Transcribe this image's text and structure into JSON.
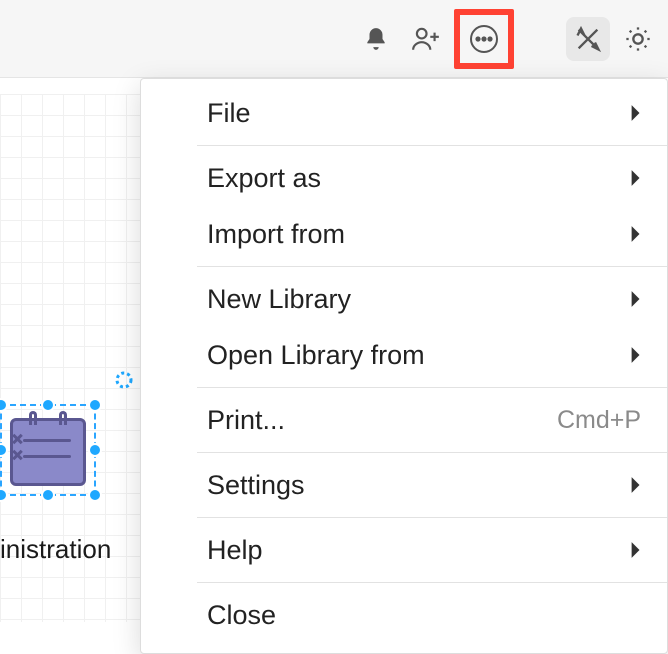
{
  "toolbar": {
    "icons": {
      "bell": "bell-icon",
      "add_user": "person-add-icon",
      "more": "more-horizontal-icon",
      "design": "design-tools-icon",
      "brightness": "brightness-icon"
    }
  },
  "canvas": {
    "selected_shape_label": "inistration"
  },
  "menu": {
    "items": [
      {
        "label": "File",
        "submenu": true
      },
      {
        "sep": true
      },
      {
        "label": "Export as",
        "submenu": true
      },
      {
        "label": "Import from",
        "submenu": true
      },
      {
        "sep": true
      },
      {
        "label": "New Library",
        "submenu": true
      },
      {
        "label": "Open Library from",
        "submenu": true
      },
      {
        "sep": true
      },
      {
        "label": "Print...",
        "shortcut": "Cmd+P"
      },
      {
        "sep": true
      },
      {
        "label": "Settings",
        "submenu": true
      },
      {
        "sep": true
      },
      {
        "label": "Help",
        "submenu": true
      },
      {
        "sep": true
      },
      {
        "label": "Close"
      }
    ]
  }
}
